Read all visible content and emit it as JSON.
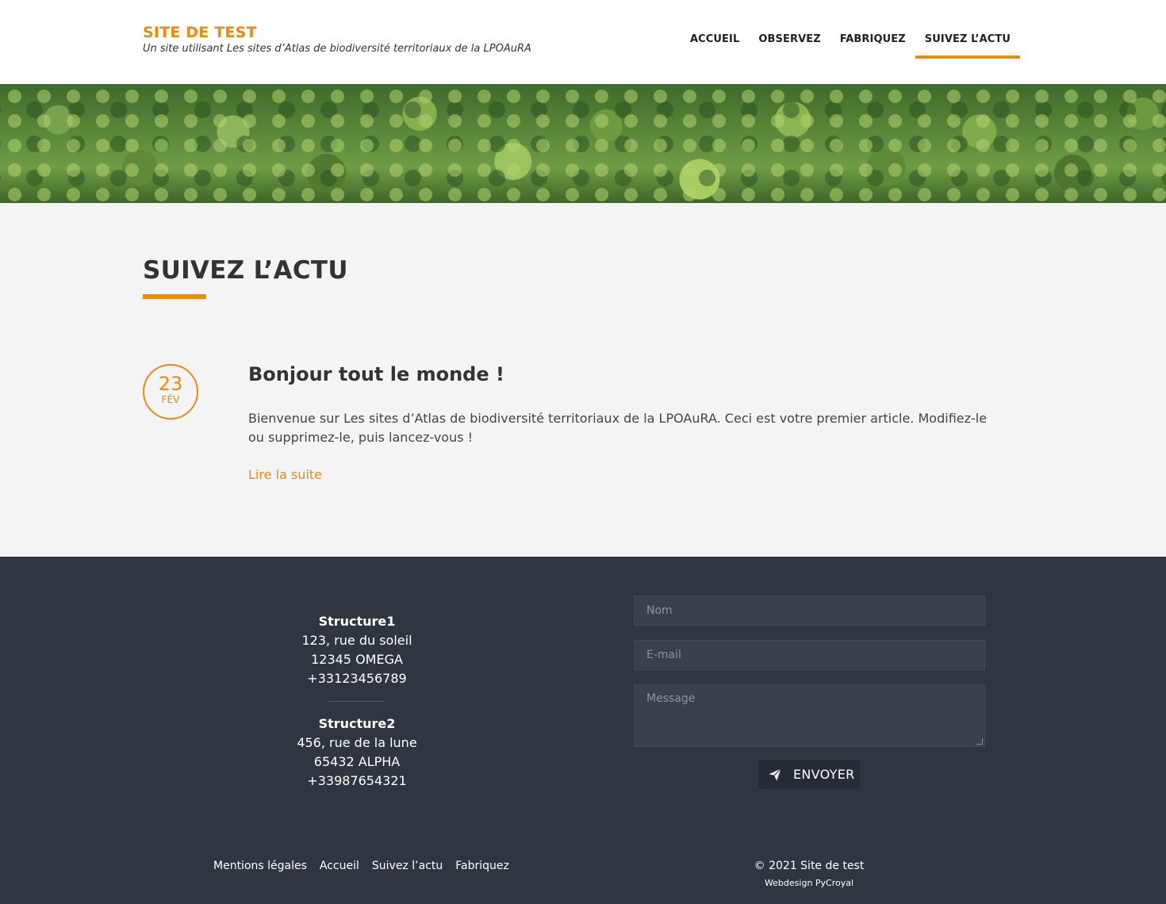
{
  "header": {
    "site_title": "SITE DE TEST",
    "site_subtitle": "Un site utilisant Les sites d’Atlas de biodiversité territoriaux de la LPOAuRA",
    "nav": [
      {
        "label": "ACCUEIL",
        "active": false
      },
      {
        "label": "OBSERVEZ",
        "active": false
      },
      {
        "label": "FABRIQUEZ",
        "active": false
      },
      {
        "label": "SUIVEZ L’ACTU",
        "active": true
      }
    ]
  },
  "main": {
    "page_title": "SUIVEZ L’ACTU",
    "post": {
      "day": "23",
      "month": "FÉV",
      "title": "Bonjour tout le monde !",
      "excerpt": "Bienvenue sur Les sites d’Atlas de biodiversité territoriaux de la LPOAuRA. Ceci est votre premier article. Modifiez-le ou supprimez-le, puis lancez-vous !",
      "read_more": "Lire la suite"
    }
  },
  "footer": {
    "contacts": [
      {
        "name": "Structure1",
        "street": "123, rue du soleil",
        "city": "12345 OMEGA",
        "phone": "+33123456789"
      },
      {
        "name": "Structure2",
        "street": "456, rue de la lune",
        "city": "65432 ALPHA",
        "phone": "+33987654321"
      }
    ],
    "form": {
      "name_placeholder": "Nom",
      "email_placeholder": "E-mail",
      "message_placeholder": "Message",
      "send_label": "ENVOYER"
    },
    "links": [
      "Mentions légales",
      "Accueil",
      "Suivez l’actu",
      "Fabriquez"
    ],
    "copyright": "© 2021 Site de test",
    "webdesign": "Webdesign PyCroyal"
  },
  "colors": {
    "accent": "#f0880a",
    "footer_bg": "#2f3640",
    "page_bg": "#f4f4f4"
  }
}
